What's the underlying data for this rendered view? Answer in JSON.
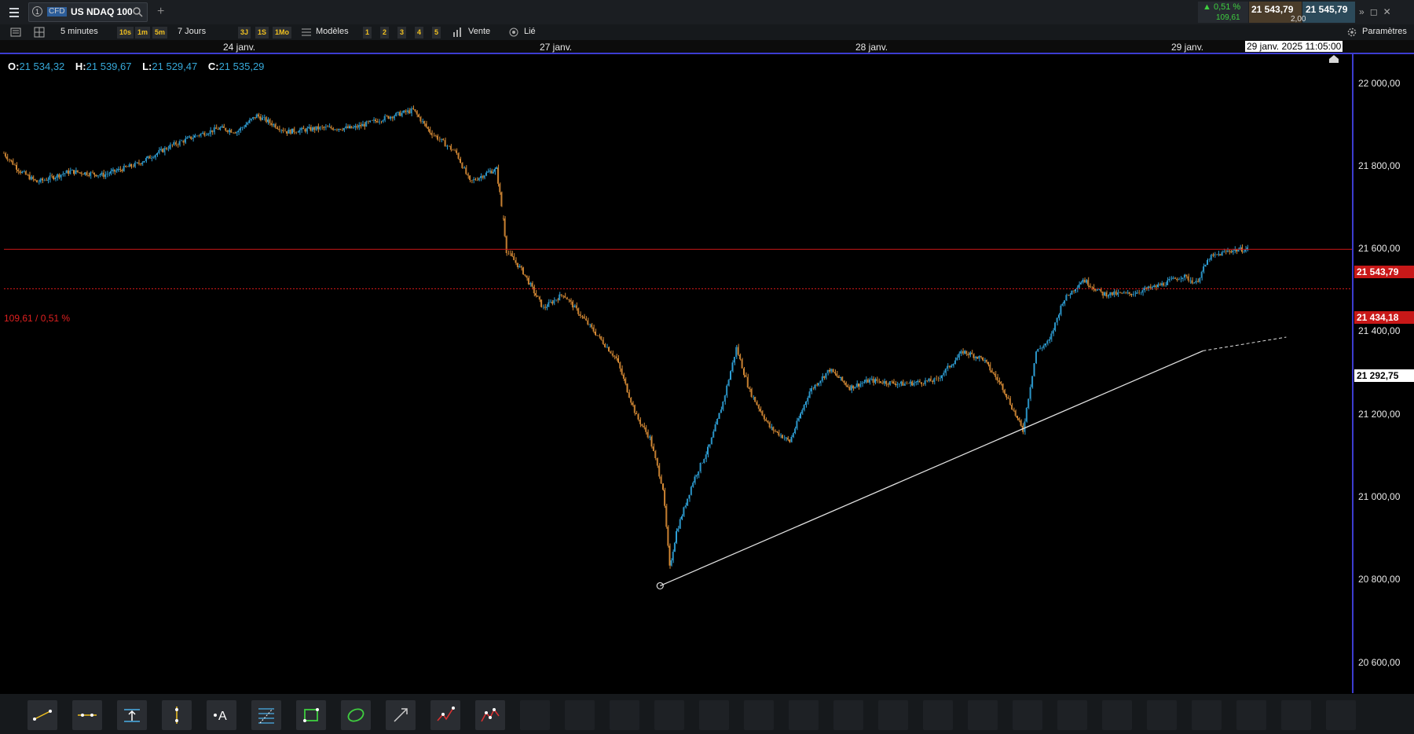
{
  "header": {
    "tab_number": "1",
    "tab_type": "CFD",
    "instrument": "US NDAQ 100",
    "change_percent": "0,51 %",
    "change_points": "109,61",
    "sell_price": "21 543,79",
    "buy_price": "21 545,79",
    "spread": "2,00"
  },
  "toolbar": {
    "interval": "5 minutes",
    "intervals_quick": [
      "10s",
      "1m",
      "5m"
    ],
    "range": "7 Jours",
    "ranges_quick": [
      "3J",
      "1S",
      "1Mo"
    ],
    "templates": "Modèles",
    "layouts": [
      "1",
      "2",
      "3",
      "4",
      "5"
    ],
    "side": "Vente",
    "link": "Lié",
    "settings": "Paramètres"
  },
  "dates": {
    "labels": [
      "24 janv.",
      "27 janv.",
      "28 janv.",
      "29 janv."
    ],
    "crosshair": "29 janv. 2025 11:05:00"
  },
  "ohlc": {
    "o_label": "O:",
    "o": "21 534,32",
    "h_label": "H:",
    "h": "21 539,67",
    "l_label": "L:",
    "l": "21 529,47",
    "c_label": "C:",
    "c": "21 535,29"
  },
  "axis": {
    "ticks": [
      "22 000,00",
      "21 800,00",
      "21 600,00",
      "21 400,00",
      "21 200,00",
      "21 000,00",
      "20 800,00",
      "20 600,00"
    ]
  },
  "price_tags": {
    "last": "21 543,79",
    "reference": "21 434,18",
    "trendline": "21 292,75"
  },
  "reference_label": "109,61 / 0,51 %",
  "colors": {
    "background": "#000000",
    "candle_up": "#2e9fd6",
    "candle_down": "#d58a35",
    "last_price_line": "#d01818",
    "axis_line": "#3c3cd0",
    "trendline": "#e0e0e0"
  },
  "chart_data": {
    "type": "candlestick",
    "interval": "5 minutes",
    "ylim": [
      20550,
      22060
    ],
    "x": [
      "24 janv.",
      "27 janv.",
      "28 janv.",
      "29 janv."
    ],
    "close_path": [
      [
        0,
        21810
      ],
      [
        0.5,
        21760
      ],
      [
        1,
        21730
      ],
      [
        2,
        21760
      ],
      [
        3,
        21750
      ],
      [
        4,
        21780
      ],
      [
        5,
        21830
      ],
      [
        5.8,
        21860
      ],
      [
        6.5,
        21880
      ],
      [
        7,
        21870
      ],
      [
        7.6,
        21915
      ],
      [
        8.5,
        21870
      ],
      [
        9.5,
        21880
      ],
      [
        10.5,
        21880
      ],
      [
        11.5,
        21910
      ],
      [
        12.3,
        21930
      ],
      [
        12.8,
        21870
      ],
      [
        13.6,
        21810
      ],
      [
        14,
        21730
      ],
      [
        14.6,
        21760
      ],
      [
        14.8,
        21765
      ],
      [
        15.0,
        21630
      ],
      [
        15.1,
        21540
      ],
      [
        15.6,
        21480
      ],
      [
        16.2,
        21380
      ],
      [
        16.8,
        21420
      ],
      [
        17.6,
        21330
      ],
      [
        18.4,
        21240
      ],
      [
        19.0,
        21080
      ],
      [
        19.4,
        21020
      ],
      [
        19.8,
        20880
      ],
      [
        20.0,
        20660
      ],
      [
        20.2,
        20760
      ],
      [
        20.7,
        20900
      ],
      [
        21.2,
        21000
      ],
      [
        21.6,
        21120
      ],
      [
        22.0,
        21270
      ],
      [
        22.4,
        21150
      ],
      [
        23.0,
        21050
      ],
      [
        23.6,
        21010
      ],
      [
        24.2,
        21150
      ],
      [
        24.8,
        21210
      ],
      [
        25.4,
        21160
      ],
      [
        26.0,
        21180
      ],
      [
        27.0,
        21170
      ],
      [
        28.0,
        21180
      ],
      [
        28.8,
        21260
      ],
      [
        29.4,
        21240
      ],
      [
        30.0,
        21160
      ],
      [
        30.6,
        21040
      ],
      [
        31.0,
        21260
      ],
      [
        31.4,
        21290
      ],
      [
        31.8,
        21400
      ],
      [
        32.4,
        21460
      ],
      [
        33.0,
        21420
      ],
      [
        33.8,
        21420
      ],
      [
        34.6,
        21440
      ],
      [
        35.4,
        21470
      ],
      [
        35.8,
        21450
      ],
      [
        36.2,
        21520
      ],
      [
        36.8,
        21540
      ],
      [
        37.4,
        21545
      ]
    ],
    "trendline": {
      "from": [
        19.7,
        20610
      ],
      "to": [
        38.5,
        21300
      ]
    }
  }
}
